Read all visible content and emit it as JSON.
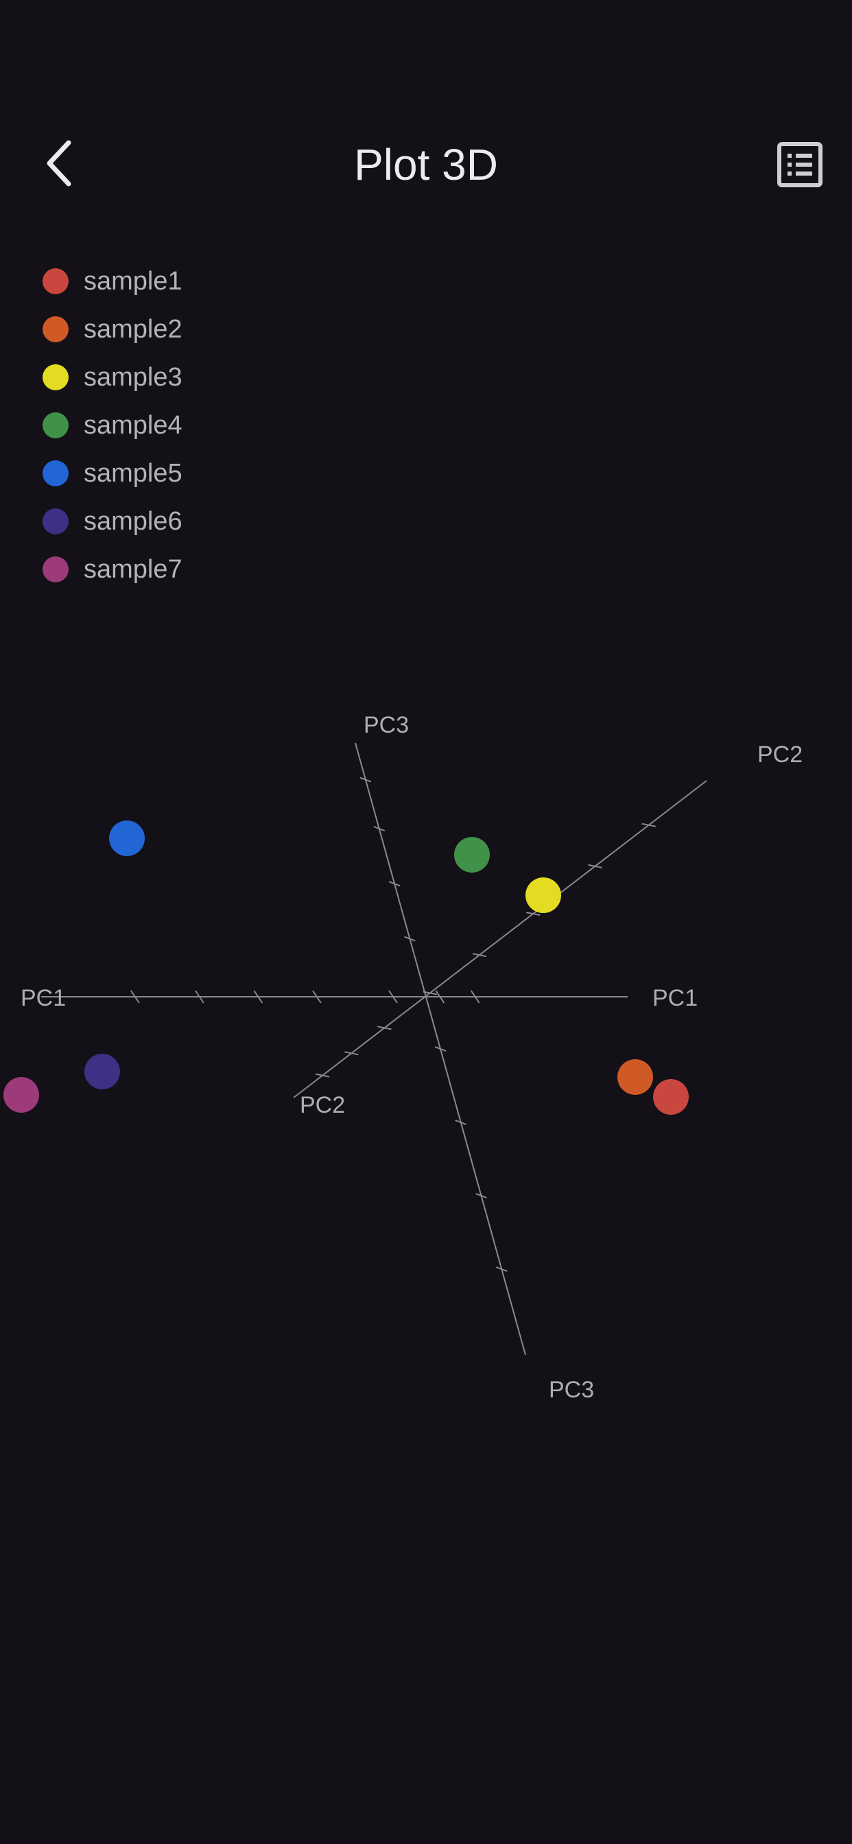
{
  "header": {
    "title": "Plot 3D",
    "back_icon": "chevron-left-icon",
    "list_icon": "list-icon"
  },
  "legend": [
    {
      "label": "sample1",
      "color": "#c9473f"
    },
    {
      "label": "sample2",
      "color": "#d05a26"
    },
    {
      "label": "sample3",
      "color": "#e3dc22"
    },
    {
      "label": "sample4",
      "color": "#3f9247"
    },
    {
      "label": "sample5",
      "color": "#2266d6"
    },
    {
      "label": "sample6",
      "color": "#3f2f85"
    },
    {
      "label": "sample7",
      "color": "#9c3a7a"
    }
  ],
  "chart_data": {
    "type": "scatter",
    "projection": "3d",
    "axes": {
      "pc1": "PC1",
      "pc2": "PC2",
      "pc3": "PC3"
    },
    "grid": false,
    "legend_placement": "top-left",
    "series": [
      {
        "name": "sample1",
        "color": "#c9473f"
      },
      {
        "name": "sample2",
        "color": "#d05a26"
      },
      {
        "name": "sample3",
        "color": "#e3dc22"
      },
      {
        "name": "sample4",
        "color": "#3f9247"
      },
      {
        "name": "sample5",
        "color": "#2266d6"
      },
      {
        "name": "sample6",
        "color": "#3f2f85"
      },
      {
        "name": "sample7",
        "color": "#9c3a7a"
      }
    ]
  }
}
